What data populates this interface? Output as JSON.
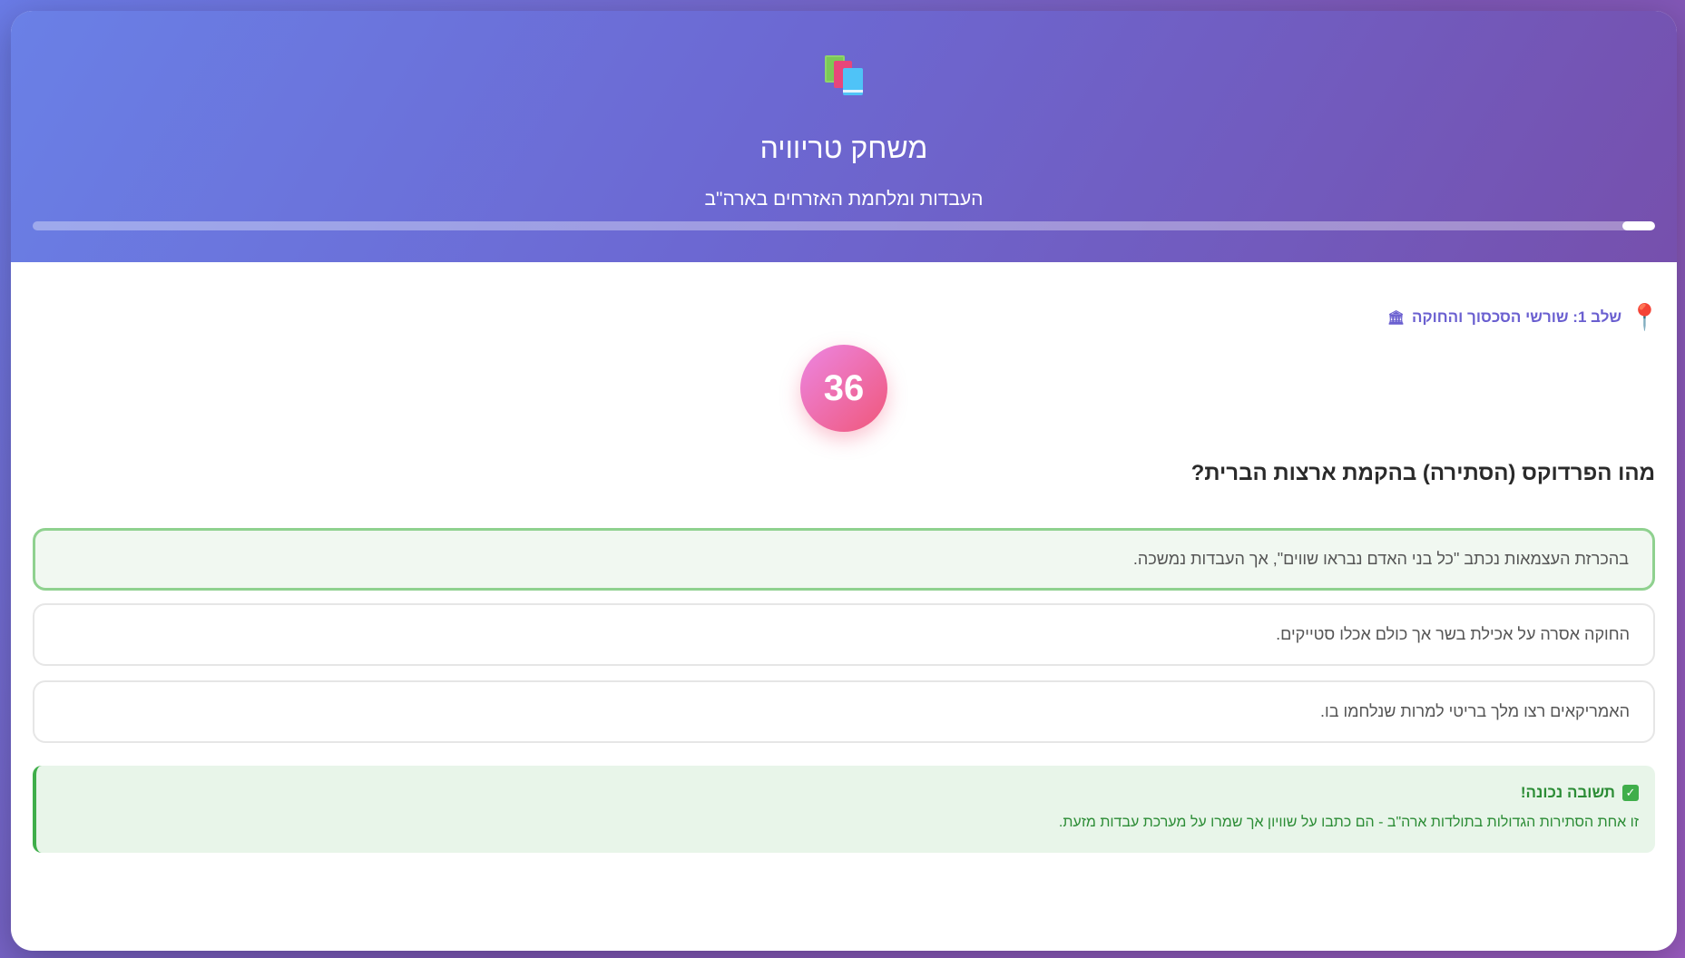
{
  "header": {
    "icon": "books-icon",
    "title": "משחק טריוויה",
    "subtitle": "העבדות ומלחמת האזרחים בארה\"ב",
    "progress": 0.02
  },
  "stage": {
    "pin_icon": "round-pushpin-icon",
    "label": "שלב 1: שורשי הסכסוך והחוקה",
    "emoji": "🏛"
  },
  "timer": {
    "value": "36"
  },
  "question": {
    "text": "מהו הפרדוקס (הסתירה) בהקמת ארצות הברית?"
  },
  "answers": [
    {
      "text": "בהכרזת העצמאות נכתב \"כל בני האדם נבראו שווים\", אך העבדות נמשכה.",
      "state": "correct"
    },
    {
      "text": "החוקה אסרה על אכילת בשר אך כולם אכלו סטייקים.",
      "state": "default"
    },
    {
      "text": "האמריקאים רצו מלך בריטי למרות שנלחמו בו.",
      "state": "default"
    }
  ],
  "feedback": {
    "title": "תשובה נכונה!",
    "text": "זו אחת הסתירות הגדולות בתולדות ארה\"ב - הם כתבו על שוויון אך שמרו על מערכת עבדות מזעת.",
    "color": "#2b8c35"
  },
  "colors": {
    "accent": "#6a5fd0",
    "correct_border": "#8fd18f",
    "timer_start": "#ec86e2",
    "timer_end": "#f0577a"
  }
}
